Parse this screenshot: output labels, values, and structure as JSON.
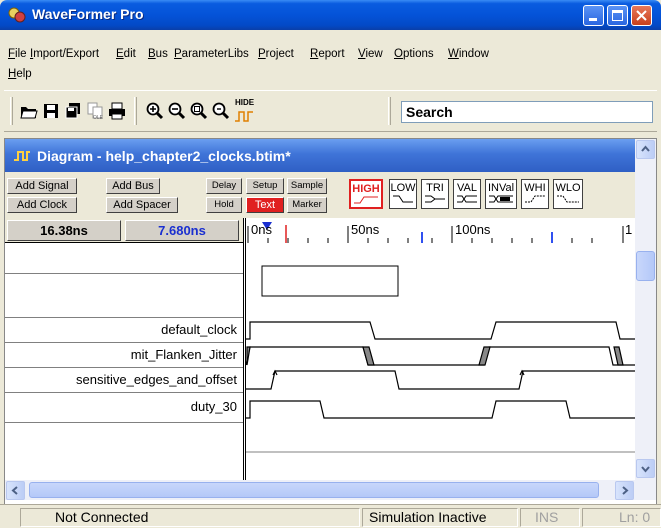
{
  "window": {
    "title": "WaveFormer Pro"
  },
  "menu": [
    "File",
    "Import/Export",
    "Edit",
    "Bus",
    "ParameterLibs",
    "Project",
    "Report",
    "View",
    "Options",
    "Window",
    "Help"
  ],
  "toolbar": {
    "hide_label": "HIDE",
    "search_value": "Search"
  },
  "diagram": {
    "title": "Diagram - help_chapter2_clocks.btim*",
    "buttons": {
      "add_signal": "Add Signal",
      "add_bus": "Add Bus",
      "add_clock": "Add Clock",
      "add_spacer": "Add Spacer",
      "delay": "Delay",
      "setup": "Setup",
      "sample": "Sample",
      "hold": "Hold",
      "text": "Text",
      "marker": "Marker"
    },
    "states": [
      "HIGH",
      "LOW",
      "TRI",
      "VAL",
      "INVal",
      "WHI",
      "WLO"
    ],
    "time_left": "16.38ns",
    "time_right": "7.680ns",
    "ticks": [
      "0ns",
      "50ns",
      "100ns",
      "1"
    ],
    "signals": [
      "default_clock",
      "mit_Flanken_Jitter",
      "sensitive_edges_and_offset",
      "duty_30"
    ]
  },
  "status": {
    "connection": "Not Connected",
    "sim": "Simulation Inactive",
    "ins": "INS",
    "ln": "Ln: 0"
  },
  "colors": {
    "accent": "#0453d8",
    "high_state": "#e02020",
    "delay_marker": "#1a2fd0"
  }
}
